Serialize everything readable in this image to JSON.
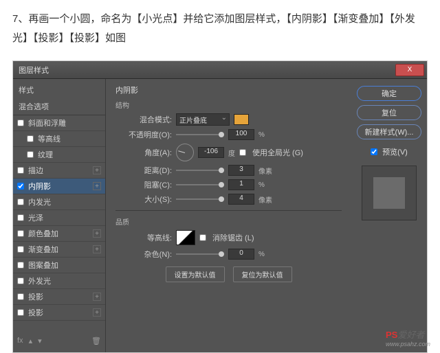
{
  "instruction": "7、再画一个小圆，命名为【小光点】并给它添加图层样式，【内阴影】【渐变叠加】【外发光】【投影】【投影】如图",
  "dialog": {
    "title": "图层样式",
    "close": "X",
    "left": {
      "head": "样式",
      "sub": "混合选项",
      "items": [
        {
          "label": "斜面和浮雕",
          "checked": false,
          "plus": false
        },
        {
          "label": "等高线",
          "checked": false,
          "plus": false,
          "indent": true
        },
        {
          "label": "纹理",
          "checked": false,
          "plus": false,
          "indent": true
        },
        {
          "label": "描边",
          "checked": false,
          "plus": true
        },
        {
          "label": "内阴影",
          "checked": true,
          "plus": true,
          "active": true
        },
        {
          "label": "内发光",
          "checked": false,
          "plus": false
        },
        {
          "label": "光泽",
          "checked": false,
          "plus": false
        },
        {
          "label": "颜色叠加",
          "checked": false,
          "plus": true
        },
        {
          "label": "渐变叠加",
          "checked": false,
          "plus": true
        },
        {
          "label": "图案叠加",
          "checked": false,
          "plus": false
        },
        {
          "label": "外发光",
          "checked": false,
          "plus": false
        },
        {
          "label": "投影",
          "checked": false,
          "plus": true
        },
        {
          "label": "投影",
          "checked": false,
          "plus": true
        }
      ],
      "footer_fx": "fx"
    },
    "center": {
      "title": "内阴影",
      "group1": "结构",
      "blend_label": "混合模式:",
      "blend_value": "正片叠底",
      "opacity_label": "不透明度(O):",
      "opacity_value": "100",
      "pct": "%",
      "angle_label": "角度(A):",
      "angle_value": "-106",
      "angle_unit": "度",
      "global_label": "使用全局光 (G)",
      "distance_label": "距离(D):",
      "distance_value": "3",
      "px": "像素",
      "choke_label": "阻塞(C):",
      "choke_value": "1",
      "size_label": "大小(S):",
      "size_value": "4",
      "group2": "品质",
      "contour_label": "等高线:",
      "antialias_label": "消除锯齿 (L)",
      "noise_label": "杂色(N):",
      "noise_value": "0",
      "btn_default": "设置为默认值",
      "btn_reset": "复位为默认值"
    },
    "right": {
      "ok": "确定",
      "cancel": "复位",
      "new_style": "新建样式(W)...",
      "preview": "预览(V)"
    }
  },
  "watermark": {
    "brand": "PS",
    "text": "爱好者",
    "url": "www.psahz.com"
  }
}
